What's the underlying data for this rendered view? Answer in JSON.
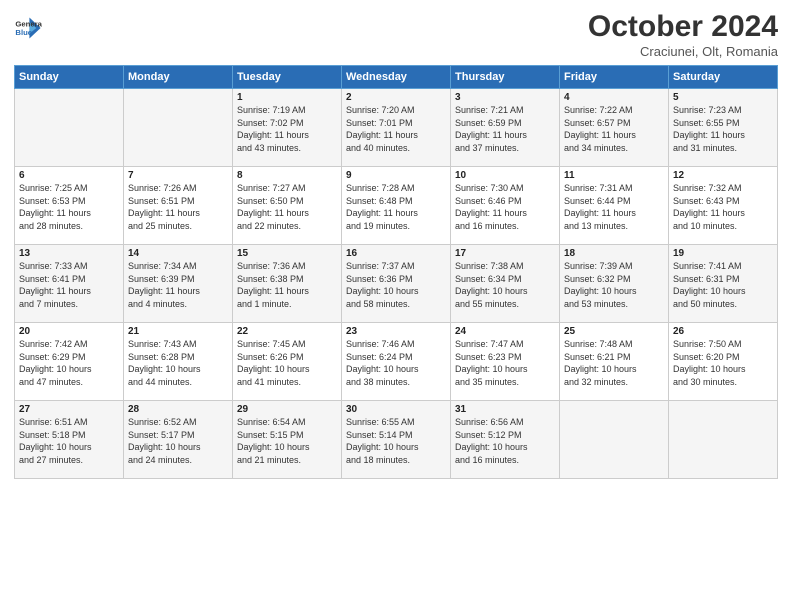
{
  "header": {
    "logo_line1": "General",
    "logo_line2": "Blue",
    "month": "October 2024",
    "location": "Craciunei, Olt, Romania"
  },
  "weekdays": [
    "Sunday",
    "Monday",
    "Tuesday",
    "Wednesday",
    "Thursday",
    "Friday",
    "Saturday"
  ],
  "weeks": [
    [
      {
        "day": "",
        "info": ""
      },
      {
        "day": "",
        "info": ""
      },
      {
        "day": "1",
        "info": "Sunrise: 7:19 AM\nSunset: 7:02 PM\nDaylight: 11 hours\nand 43 minutes."
      },
      {
        "day": "2",
        "info": "Sunrise: 7:20 AM\nSunset: 7:01 PM\nDaylight: 11 hours\nand 40 minutes."
      },
      {
        "day": "3",
        "info": "Sunrise: 7:21 AM\nSunset: 6:59 PM\nDaylight: 11 hours\nand 37 minutes."
      },
      {
        "day": "4",
        "info": "Sunrise: 7:22 AM\nSunset: 6:57 PM\nDaylight: 11 hours\nand 34 minutes."
      },
      {
        "day": "5",
        "info": "Sunrise: 7:23 AM\nSunset: 6:55 PM\nDaylight: 11 hours\nand 31 minutes."
      }
    ],
    [
      {
        "day": "6",
        "info": "Sunrise: 7:25 AM\nSunset: 6:53 PM\nDaylight: 11 hours\nand 28 minutes."
      },
      {
        "day": "7",
        "info": "Sunrise: 7:26 AM\nSunset: 6:51 PM\nDaylight: 11 hours\nand 25 minutes."
      },
      {
        "day": "8",
        "info": "Sunrise: 7:27 AM\nSunset: 6:50 PM\nDaylight: 11 hours\nand 22 minutes."
      },
      {
        "day": "9",
        "info": "Sunrise: 7:28 AM\nSunset: 6:48 PM\nDaylight: 11 hours\nand 19 minutes."
      },
      {
        "day": "10",
        "info": "Sunrise: 7:30 AM\nSunset: 6:46 PM\nDaylight: 11 hours\nand 16 minutes."
      },
      {
        "day": "11",
        "info": "Sunrise: 7:31 AM\nSunset: 6:44 PM\nDaylight: 11 hours\nand 13 minutes."
      },
      {
        "day": "12",
        "info": "Sunrise: 7:32 AM\nSunset: 6:43 PM\nDaylight: 11 hours\nand 10 minutes."
      }
    ],
    [
      {
        "day": "13",
        "info": "Sunrise: 7:33 AM\nSunset: 6:41 PM\nDaylight: 11 hours\nand 7 minutes."
      },
      {
        "day": "14",
        "info": "Sunrise: 7:34 AM\nSunset: 6:39 PM\nDaylight: 11 hours\nand 4 minutes."
      },
      {
        "day": "15",
        "info": "Sunrise: 7:36 AM\nSunset: 6:38 PM\nDaylight: 11 hours\nand 1 minute."
      },
      {
        "day": "16",
        "info": "Sunrise: 7:37 AM\nSunset: 6:36 PM\nDaylight: 10 hours\nand 58 minutes."
      },
      {
        "day": "17",
        "info": "Sunrise: 7:38 AM\nSunset: 6:34 PM\nDaylight: 10 hours\nand 55 minutes."
      },
      {
        "day": "18",
        "info": "Sunrise: 7:39 AM\nSunset: 6:32 PM\nDaylight: 10 hours\nand 53 minutes."
      },
      {
        "day": "19",
        "info": "Sunrise: 7:41 AM\nSunset: 6:31 PM\nDaylight: 10 hours\nand 50 minutes."
      }
    ],
    [
      {
        "day": "20",
        "info": "Sunrise: 7:42 AM\nSunset: 6:29 PM\nDaylight: 10 hours\nand 47 minutes."
      },
      {
        "day": "21",
        "info": "Sunrise: 7:43 AM\nSunset: 6:28 PM\nDaylight: 10 hours\nand 44 minutes."
      },
      {
        "day": "22",
        "info": "Sunrise: 7:45 AM\nSunset: 6:26 PM\nDaylight: 10 hours\nand 41 minutes."
      },
      {
        "day": "23",
        "info": "Sunrise: 7:46 AM\nSunset: 6:24 PM\nDaylight: 10 hours\nand 38 minutes."
      },
      {
        "day": "24",
        "info": "Sunrise: 7:47 AM\nSunset: 6:23 PM\nDaylight: 10 hours\nand 35 minutes."
      },
      {
        "day": "25",
        "info": "Sunrise: 7:48 AM\nSunset: 6:21 PM\nDaylight: 10 hours\nand 32 minutes."
      },
      {
        "day": "26",
        "info": "Sunrise: 7:50 AM\nSunset: 6:20 PM\nDaylight: 10 hours\nand 30 minutes."
      }
    ],
    [
      {
        "day": "27",
        "info": "Sunrise: 6:51 AM\nSunset: 5:18 PM\nDaylight: 10 hours\nand 27 minutes."
      },
      {
        "day": "28",
        "info": "Sunrise: 6:52 AM\nSunset: 5:17 PM\nDaylight: 10 hours\nand 24 minutes."
      },
      {
        "day": "29",
        "info": "Sunrise: 6:54 AM\nSunset: 5:15 PM\nDaylight: 10 hours\nand 21 minutes."
      },
      {
        "day": "30",
        "info": "Sunrise: 6:55 AM\nSunset: 5:14 PM\nDaylight: 10 hours\nand 18 minutes."
      },
      {
        "day": "31",
        "info": "Sunrise: 6:56 AM\nSunset: 5:12 PM\nDaylight: 10 hours\nand 16 minutes."
      },
      {
        "day": "",
        "info": ""
      },
      {
        "day": "",
        "info": ""
      }
    ]
  ]
}
